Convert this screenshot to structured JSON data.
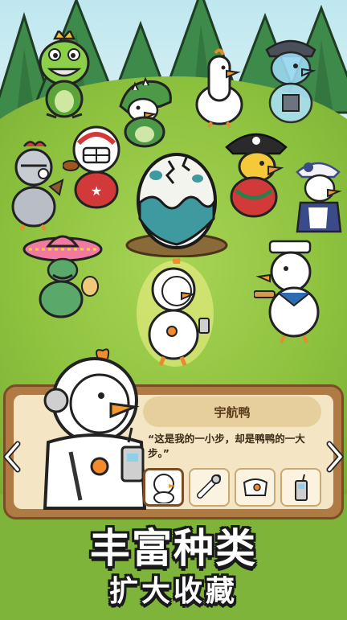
{
  "character_card": {
    "name": "宇航鸭",
    "quote": "“这是我的一小步，却是鸭鸭的一大步。”"
  },
  "thumbnails": [
    {
      "icon": "astronaut-duck-icon",
      "selected": true
    },
    {
      "icon": "space-helmet-icon",
      "selected": false
    },
    {
      "icon": "space-suit-icon",
      "selected": false
    },
    {
      "icon": "walkie-talkie-icon",
      "selected": false
    }
  ],
  "nav": {
    "prev_icon": "chevron-left-icon",
    "next_icon": "chevron-right-icon"
  },
  "banner": {
    "headline": "丰富种类",
    "subheadline": "扩大收藏"
  },
  "colors": {
    "grass": "#8cc13e",
    "panel_wood": "#b07a45",
    "panel_paper": "#f4e6c5",
    "egg_teal": "#3f9aa0",
    "headline_text": "#ffffff",
    "outline": "#1a1a1a"
  },
  "characters": [
    "frog-king-icon",
    "white-duck-icon",
    "ghost-pirate-duck-icon",
    "dinosaur-costume-duck-icon",
    "football-duck-icon",
    "knight-duck-icon",
    "pirate-captain-duck-icon",
    "maid-duck-icon",
    "mariachi-cactus-duck-icon",
    "sailor-duck-icon",
    "astronaut-duck-icon",
    "mystery-egg-icon"
  ]
}
